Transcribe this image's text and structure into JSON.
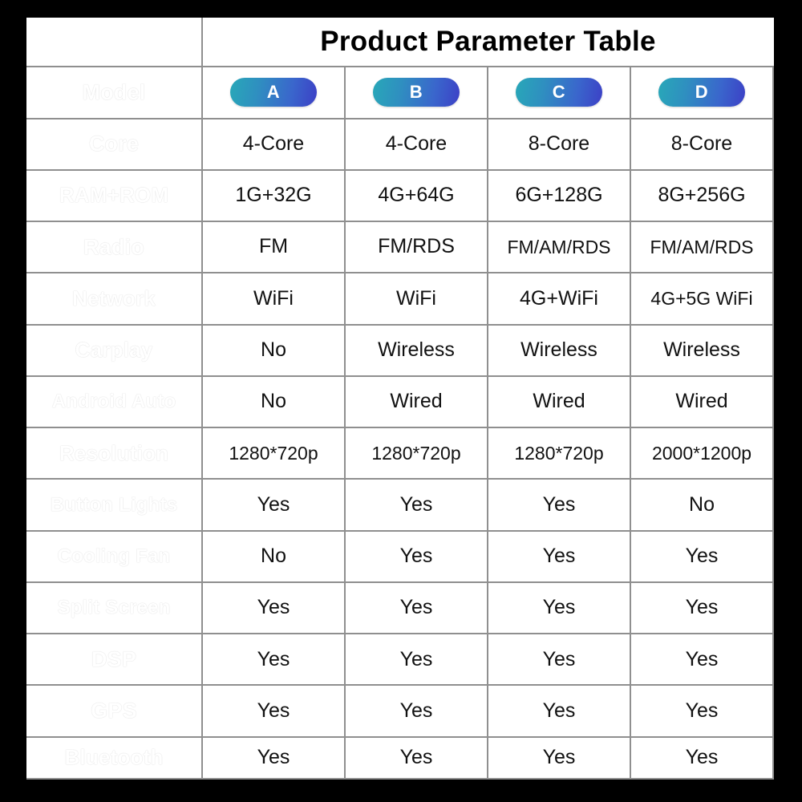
{
  "title": "Product Parameter Table",
  "colors": {
    "gradient_top": "#9e3438",
    "gradient_mid": "#6b4477",
    "gradient_bottom": "#2f45ad",
    "pill_start": "#28a8b8",
    "pill_end": "#3c40c6",
    "grid_line": "#8f8f8f",
    "page_background": "#000000",
    "cell_background": "#ffffff"
  },
  "table": {
    "label_column_header": "",
    "model_row_label": "Model",
    "models": [
      "A",
      "B",
      "C",
      "D"
    ],
    "rows": [
      {
        "label": "Model",
        "values": [
          "A",
          "B",
          "C",
          "D"
        ]
      },
      {
        "label": "Core",
        "values": [
          "4-Core",
          "4-Core",
          "8-Core",
          "8-Core"
        ]
      },
      {
        "label": "RAM+ROM",
        "values": [
          "1G+32G",
          "4G+64G",
          "6G+128G",
          "8G+256G"
        ]
      },
      {
        "label": "Radio",
        "values": [
          "FM",
          "FM/RDS",
          "FM/AM/RDS",
          "FM/AM/RDS"
        ]
      },
      {
        "label": "Network",
        "values": [
          "WiFi",
          "WiFi",
          "4G+WiFi",
          "4G+5G WiFi"
        ]
      },
      {
        "label": "Carplay",
        "values": [
          "No",
          "Wireless",
          "Wireless",
          "Wireless"
        ]
      },
      {
        "label": "Android Auto",
        "values": [
          "No",
          "Wired",
          "Wired",
          "Wired"
        ]
      },
      {
        "label": "Resolution",
        "values": [
          "1280*720p",
          "1280*720p",
          "1280*720p",
          "2000*1200p"
        ]
      },
      {
        "label": "Button Lights",
        "values": [
          "Yes",
          "Yes",
          "Yes",
          "No"
        ]
      },
      {
        "label": "Cooling Fan",
        "values": [
          "No",
          "Yes",
          "Yes",
          "Yes"
        ]
      },
      {
        "label": "Split Screen",
        "values": [
          "Yes",
          "Yes",
          "Yes",
          "Yes"
        ]
      },
      {
        "label": "DSP",
        "values": [
          "Yes",
          "Yes",
          "Yes",
          "Yes"
        ]
      },
      {
        "label": "GPS",
        "values": [
          "Yes",
          "Yes",
          "Yes",
          "Yes"
        ]
      },
      {
        "label": "Bluetooth",
        "values": [
          "Yes",
          "Yes",
          "Yes",
          "Yes"
        ]
      }
    ]
  }
}
